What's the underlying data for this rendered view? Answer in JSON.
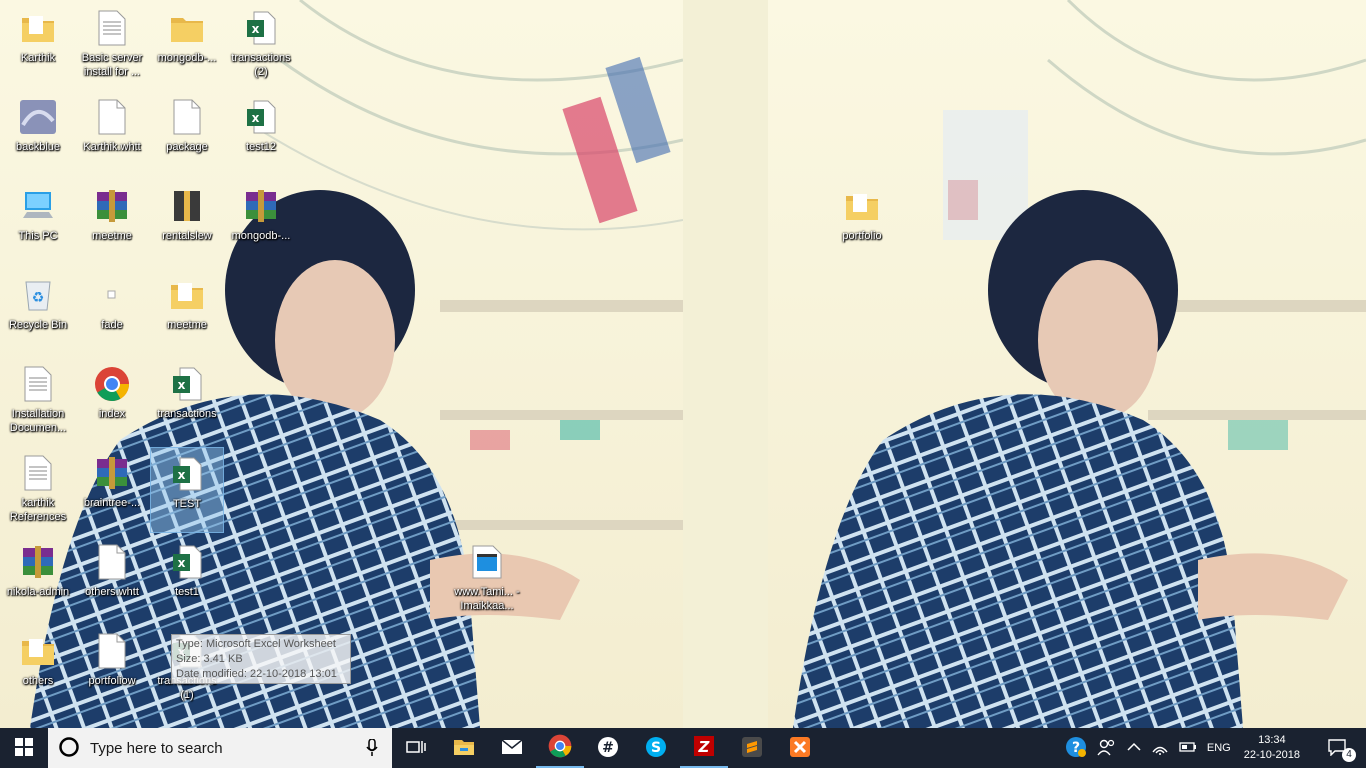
{
  "desktop": {
    "icons": [
      {
        "label": "Karthik",
        "icon": "folder-icon"
      },
      {
        "label": "Basic server install for ...",
        "icon": "text-file-icon"
      },
      {
        "label": "mongodb-...",
        "icon": "folder-icon"
      },
      {
        "label": "transactions (2)",
        "icon": "excel-file-icon"
      },
      {
        "label": "backblue",
        "icon": "image-file-icon"
      },
      {
        "label": "Karthik.whtt",
        "icon": "blank-file-icon"
      },
      {
        "label": "package",
        "icon": "blank-file-icon"
      },
      {
        "label": "test12",
        "icon": "excel-file-icon"
      },
      {
        "label": "This PC",
        "icon": "computer-icon"
      },
      {
        "label": "meetme",
        "icon": "winrar-archive-icon"
      },
      {
        "label": "rentalslew",
        "icon": "archive-folder-icon"
      },
      {
        "label": "mongodb-...",
        "icon": "winrar-archive-icon"
      },
      {
        "label": "Recycle Bin",
        "icon": "recycle-bin-icon"
      },
      {
        "label": "fade",
        "icon": "small-file-icon"
      },
      {
        "label": "meetme",
        "icon": "folder-icon"
      },
      {
        "label": "Installation Documen...",
        "icon": "text-file-icon"
      },
      {
        "label": "index",
        "icon": "chrome-icon"
      },
      {
        "label": "transactions",
        "icon": "excel-file-icon"
      },
      {
        "label": "karthik References",
        "icon": "text-file-icon"
      },
      {
        "label": "braintree-...",
        "icon": "winrar-archive-icon"
      },
      {
        "label": "TEST",
        "icon": "excel-file-icon"
      },
      {
        "label": "nikola-admin",
        "icon": "winrar-archive-icon"
      },
      {
        "label": "others.whtt",
        "icon": "blank-file-icon"
      },
      {
        "label": "test1",
        "icon": "excel-file-icon"
      },
      {
        "label": "others",
        "icon": "folder-icon"
      },
      {
        "label": "portfoliow",
        "icon": "blank-file-icon"
      },
      {
        "label": "transactions (1)",
        "icon": "excel-file-icon"
      },
      {
        "label": "www.Tami... - Imaikkaa...",
        "icon": "video-file-icon"
      },
      {
        "label": "portfolio",
        "icon": "folder-icon"
      }
    ],
    "tooltip": {
      "type": "Type: Microsoft Excel Worksheet",
      "size": "Size: 3.41 KB",
      "modified": "Date modified: 22-10-2018 13:01"
    }
  },
  "taskbar": {
    "search_placeholder": "Type here to search",
    "pinned": [
      {
        "name": "task-view-icon"
      },
      {
        "name": "file-explorer-icon"
      },
      {
        "name": "mail-icon"
      },
      {
        "name": "chrome-icon"
      },
      {
        "name": "slack-icon"
      },
      {
        "name": "skype-icon"
      },
      {
        "name": "filezilla-icon"
      },
      {
        "name": "sublime-text-icon"
      },
      {
        "name": "xampp-icon"
      }
    ],
    "tray": {
      "language": "ENG",
      "time": "13:34",
      "date": "22-10-2018",
      "notification_count": "4"
    }
  },
  "colors": {
    "taskbar_bg": "#1a2230",
    "accent": "#76b9ed",
    "excel_green": "#1e7145"
  }
}
